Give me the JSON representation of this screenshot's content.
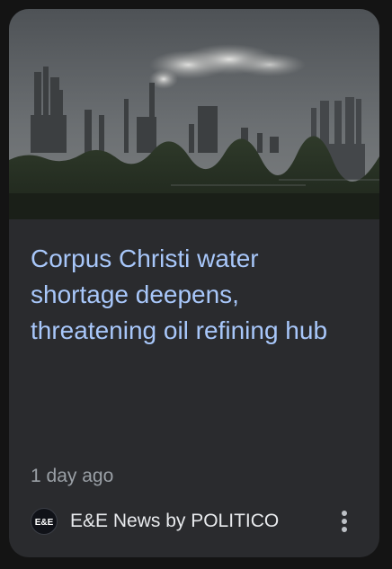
{
  "article": {
    "headline": "Corpus Christi water shortage deepens, threatening oil refining hub",
    "timestamp": "1 day ago",
    "image_description": "Oil refinery stacks with smoke plume over a line of trees"
  },
  "source": {
    "name": "E&E News by POLITICO",
    "logo_text": "E&E",
    "logo_icon": "ee-news-logo"
  },
  "actions": {
    "more_icon": "more-vert-icon"
  },
  "colors": {
    "page_background": "#141414",
    "card_background": "#2a2b2e",
    "headline": "#a8c7fa",
    "timestamp": "#9aa0a6",
    "source_name": "#e8eaed"
  }
}
